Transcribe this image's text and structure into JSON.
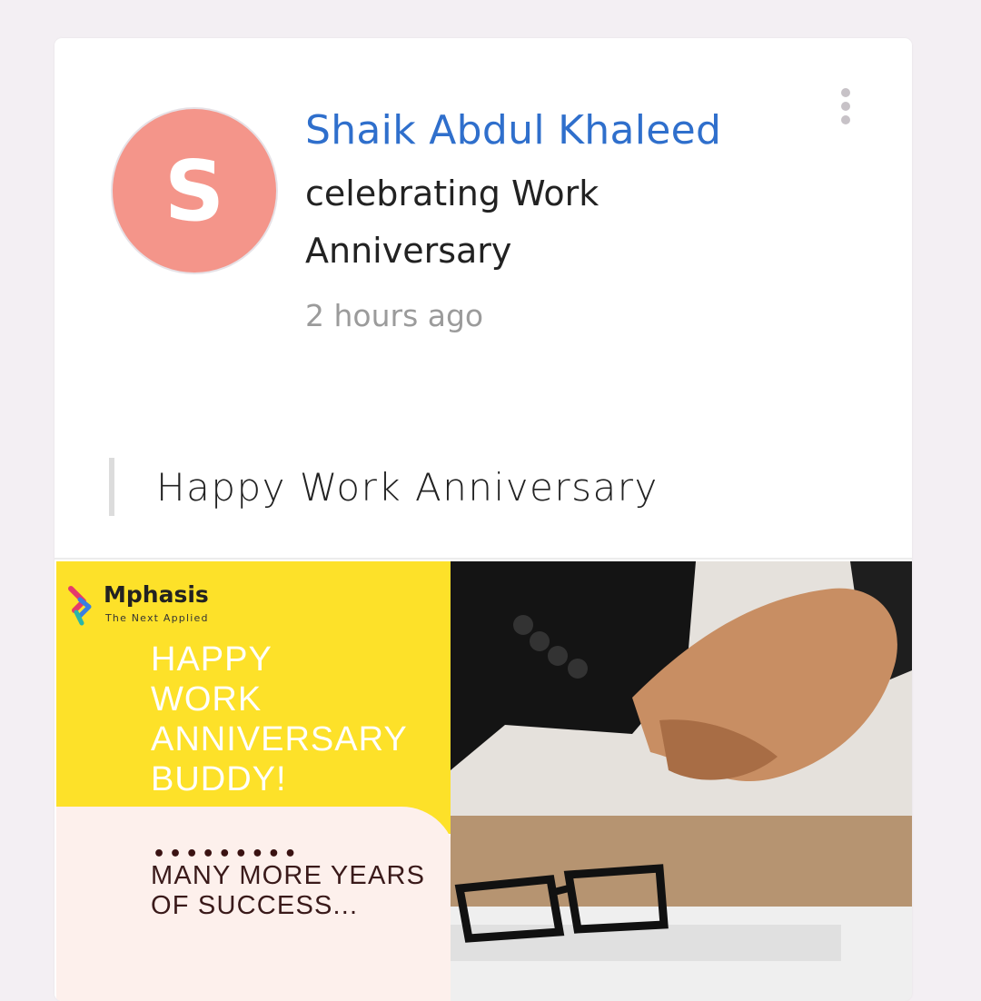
{
  "post": {
    "avatar_initial": "S",
    "author_name": "Shaik Abdul Khaleed",
    "action_text": "celebrating Work Anniversary",
    "timestamp": "2 hours ago",
    "message": "Happy Work Anniversary"
  },
  "menu": {
    "icon": "more-vertical-icon"
  },
  "image": {
    "brand": "Mphasis",
    "brand_tagline": "The Next Applied",
    "headline": "HAPPY\nWORK\nANNIVERSARY\nBUDDY!",
    "separator": "•••••••••",
    "tagline": "MANY MORE YEARS\nOF SUCCESS..."
  },
  "colors": {
    "author": "#2f6fcc",
    "avatar": "#f4958a",
    "yellow": "#fde129",
    "background": "#f3eff3"
  }
}
